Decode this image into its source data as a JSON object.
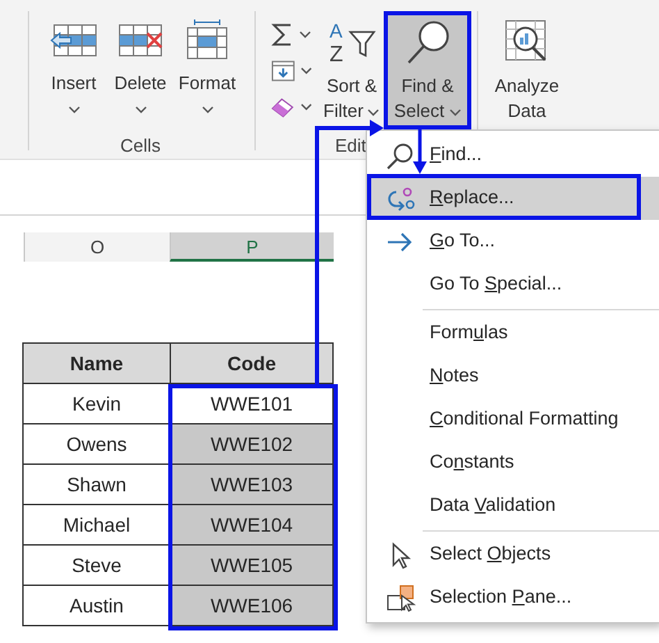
{
  "ribbon": {
    "groups": [
      {
        "label": "Cells",
        "buttons": [
          {
            "kind": "large",
            "label": "Insert",
            "dropdown": true,
            "pressed": false
          },
          {
            "kind": "large",
            "label": "Delete",
            "dropdown": true,
            "pressed": false
          },
          {
            "kind": "large",
            "label": "Format",
            "dropdown": true,
            "pressed": false
          }
        ]
      },
      {
        "label": "Edit",
        "buttons": [
          {
            "kind": "stack",
            "items": [
              {
                "dropdown": true
              },
              {
                "dropdown": true
              },
              {
                "dropdown": true
              }
            ]
          },
          {
            "kind": "large-wrap",
            "icon_letters": [
              "A",
              "Z"
            ],
            "label": "Sort & Filter",
            "dropdown": true,
            "pressed": false
          },
          {
            "kind": "large-wrap",
            "label": "Find & Select",
            "dropdown": true,
            "pressed": true
          }
        ]
      },
      {
        "buttons": [
          {
            "kind": "large-wrap",
            "label": "Analyze Data",
            "pressed": false
          }
        ]
      }
    ]
  },
  "sheet": {
    "column_headers": [
      {
        "label": "O",
        "selected": false
      },
      {
        "label": "P",
        "selected": true
      }
    ],
    "table": {
      "columns": [
        "Name",
        "Code"
      ],
      "rows": [
        {
          "name": "Kevin",
          "code": "WWE101",
          "code_selected": false
        },
        {
          "name": "Owens",
          "code": "WWE102",
          "code_selected": true
        },
        {
          "name": "Shawn",
          "code": "WWE103",
          "code_selected": true
        },
        {
          "name": "Michael",
          "code": "WWE104",
          "code_selected": true
        },
        {
          "name": "Steve",
          "code": "WWE105",
          "code_selected": true
        },
        {
          "name": "Austin",
          "code": "WWE106",
          "code_selected": true
        }
      ]
    }
  },
  "menu": {
    "items": [
      {
        "kind": "item",
        "key": "F",
        "post": "ind...",
        "selected": false
      },
      {
        "kind": "item",
        "key": "R",
        "post": "eplace...",
        "selected": true
      },
      {
        "kind": "item",
        "key": "G",
        "post": "o To...",
        "selected": false
      },
      {
        "kind": "item",
        "pre": "Go To ",
        "key": "S",
        "post": "pecial...",
        "selected": false
      },
      {
        "kind": "separator"
      },
      {
        "kind": "item",
        "pre": "Form",
        "key": "u",
        "post": "las",
        "selected": false
      },
      {
        "kind": "item",
        "key": "N",
        "post": "otes",
        "selected": false
      },
      {
        "kind": "item",
        "key": "C",
        "post": "onditional Formatting",
        "selected": false
      },
      {
        "kind": "item",
        "pre": "Co",
        "key": "n",
        "post": "stants",
        "selected": false
      },
      {
        "kind": "item",
        "pre": "Data ",
        "key": "V",
        "post": "alidation",
        "selected": false
      },
      {
        "kind": "separator"
      },
      {
        "kind": "item",
        "pre": "Select ",
        "key": "O",
        "post": "bjects",
        "selected": false
      },
      {
        "kind": "item",
        "pre": "Selection ",
        "key": "P",
        "post": "ane...",
        "selected": false
      }
    ]
  }
}
